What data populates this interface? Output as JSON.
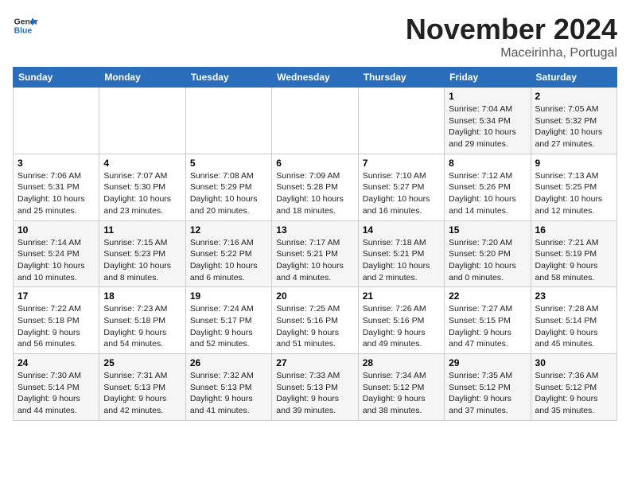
{
  "header": {
    "logo_general": "General",
    "logo_blue": "Blue",
    "month_title": "November 2024",
    "location": "Maceirinha, Portugal"
  },
  "calendar": {
    "days_of_week": [
      "Sunday",
      "Monday",
      "Tuesday",
      "Wednesday",
      "Thursday",
      "Friday",
      "Saturday"
    ],
    "weeks": [
      [
        {
          "day": "",
          "info": ""
        },
        {
          "day": "",
          "info": ""
        },
        {
          "day": "",
          "info": ""
        },
        {
          "day": "",
          "info": ""
        },
        {
          "day": "",
          "info": ""
        },
        {
          "day": "1",
          "info": "Sunrise: 7:04 AM\nSunset: 5:34 PM\nDaylight: 10 hours and 29 minutes."
        },
        {
          "day": "2",
          "info": "Sunrise: 7:05 AM\nSunset: 5:32 PM\nDaylight: 10 hours and 27 minutes."
        }
      ],
      [
        {
          "day": "3",
          "info": "Sunrise: 7:06 AM\nSunset: 5:31 PM\nDaylight: 10 hours and 25 minutes."
        },
        {
          "day": "4",
          "info": "Sunrise: 7:07 AM\nSunset: 5:30 PM\nDaylight: 10 hours and 23 minutes."
        },
        {
          "day": "5",
          "info": "Sunrise: 7:08 AM\nSunset: 5:29 PM\nDaylight: 10 hours and 20 minutes."
        },
        {
          "day": "6",
          "info": "Sunrise: 7:09 AM\nSunset: 5:28 PM\nDaylight: 10 hours and 18 minutes."
        },
        {
          "day": "7",
          "info": "Sunrise: 7:10 AM\nSunset: 5:27 PM\nDaylight: 10 hours and 16 minutes."
        },
        {
          "day": "8",
          "info": "Sunrise: 7:12 AM\nSunset: 5:26 PM\nDaylight: 10 hours and 14 minutes."
        },
        {
          "day": "9",
          "info": "Sunrise: 7:13 AM\nSunset: 5:25 PM\nDaylight: 10 hours and 12 minutes."
        }
      ],
      [
        {
          "day": "10",
          "info": "Sunrise: 7:14 AM\nSunset: 5:24 PM\nDaylight: 10 hours and 10 minutes."
        },
        {
          "day": "11",
          "info": "Sunrise: 7:15 AM\nSunset: 5:23 PM\nDaylight: 10 hours and 8 minutes."
        },
        {
          "day": "12",
          "info": "Sunrise: 7:16 AM\nSunset: 5:22 PM\nDaylight: 10 hours and 6 minutes."
        },
        {
          "day": "13",
          "info": "Sunrise: 7:17 AM\nSunset: 5:21 PM\nDaylight: 10 hours and 4 minutes."
        },
        {
          "day": "14",
          "info": "Sunrise: 7:18 AM\nSunset: 5:21 PM\nDaylight: 10 hours and 2 minutes."
        },
        {
          "day": "15",
          "info": "Sunrise: 7:20 AM\nSunset: 5:20 PM\nDaylight: 10 hours and 0 minutes."
        },
        {
          "day": "16",
          "info": "Sunrise: 7:21 AM\nSunset: 5:19 PM\nDaylight: 9 hours and 58 minutes."
        }
      ],
      [
        {
          "day": "17",
          "info": "Sunrise: 7:22 AM\nSunset: 5:18 PM\nDaylight: 9 hours and 56 minutes."
        },
        {
          "day": "18",
          "info": "Sunrise: 7:23 AM\nSunset: 5:18 PM\nDaylight: 9 hours and 54 minutes."
        },
        {
          "day": "19",
          "info": "Sunrise: 7:24 AM\nSunset: 5:17 PM\nDaylight: 9 hours and 52 minutes."
        },
        {
          "day": "20",
          "info": "Sunrise: 7:25 AM\nSunset: 5:16 PM\nDaylight: 9 hours and 51 minutes."
        },
        {
          "day": "21",
          "info": "Sunrise: 7:26 AM\nSunset: 5:16 PM\nDaylight: 9 hours and 49 minutes."
        },
        {
          "day": "22",
          "info": "Sunrise: 7:27 AM\nSunset: 5:15 PM\nDaylight: 9 hours and 47 minutes."
        },
        {
          "day": "23",
          "info": "Sunrise: 7:28 AM\nSunset: 5:14 PM\nDaylight: 9 hours and 45 minutes."
        }
      ],
      [
        {
          "day": "24",
          "info": "Sunrise: 7:30 AM\nSunset: 5:14 PM\nDaylight: 9 hours and 44 minutes."
        },
        {
          "day": "25",
          "info": "Sunrise: 7:31 AM\nSunset: 5:13 PM\nDaylight: 9 hours and 42 minutes."
        },
        {
          "day": "26",
          "info": "Sunrise: 7:32 AM\nSunset: 5:13 PM\nDaylight: 9 hours and 41 minutes."
        },
        {
          "day": "27",
          "info": "Sunrise: 7:33 AM\nSunset: 5:13 PM\nDaylight: 9 hours and 39 minutes."
        },
        {
          "day": "28",
          "info": "Sunrise: 7:34 AM\nSunset: 5:12 PM\nDaylight: 9 hours and 38 minutes."
        },
        {
          "day": "29",
          "info": "Sunrise: 7:35 AM\nSunset: 5:12 PM\nDaylight: 9 hours and 37 minutes."
        },
        {
          "day": "30",
          "info": "Sunrise: 7:36 AM\nSunset: 5:12 PM\nDaylight: 9 hours and 35 minutes."
        }
      ]
    ]
  }
}
